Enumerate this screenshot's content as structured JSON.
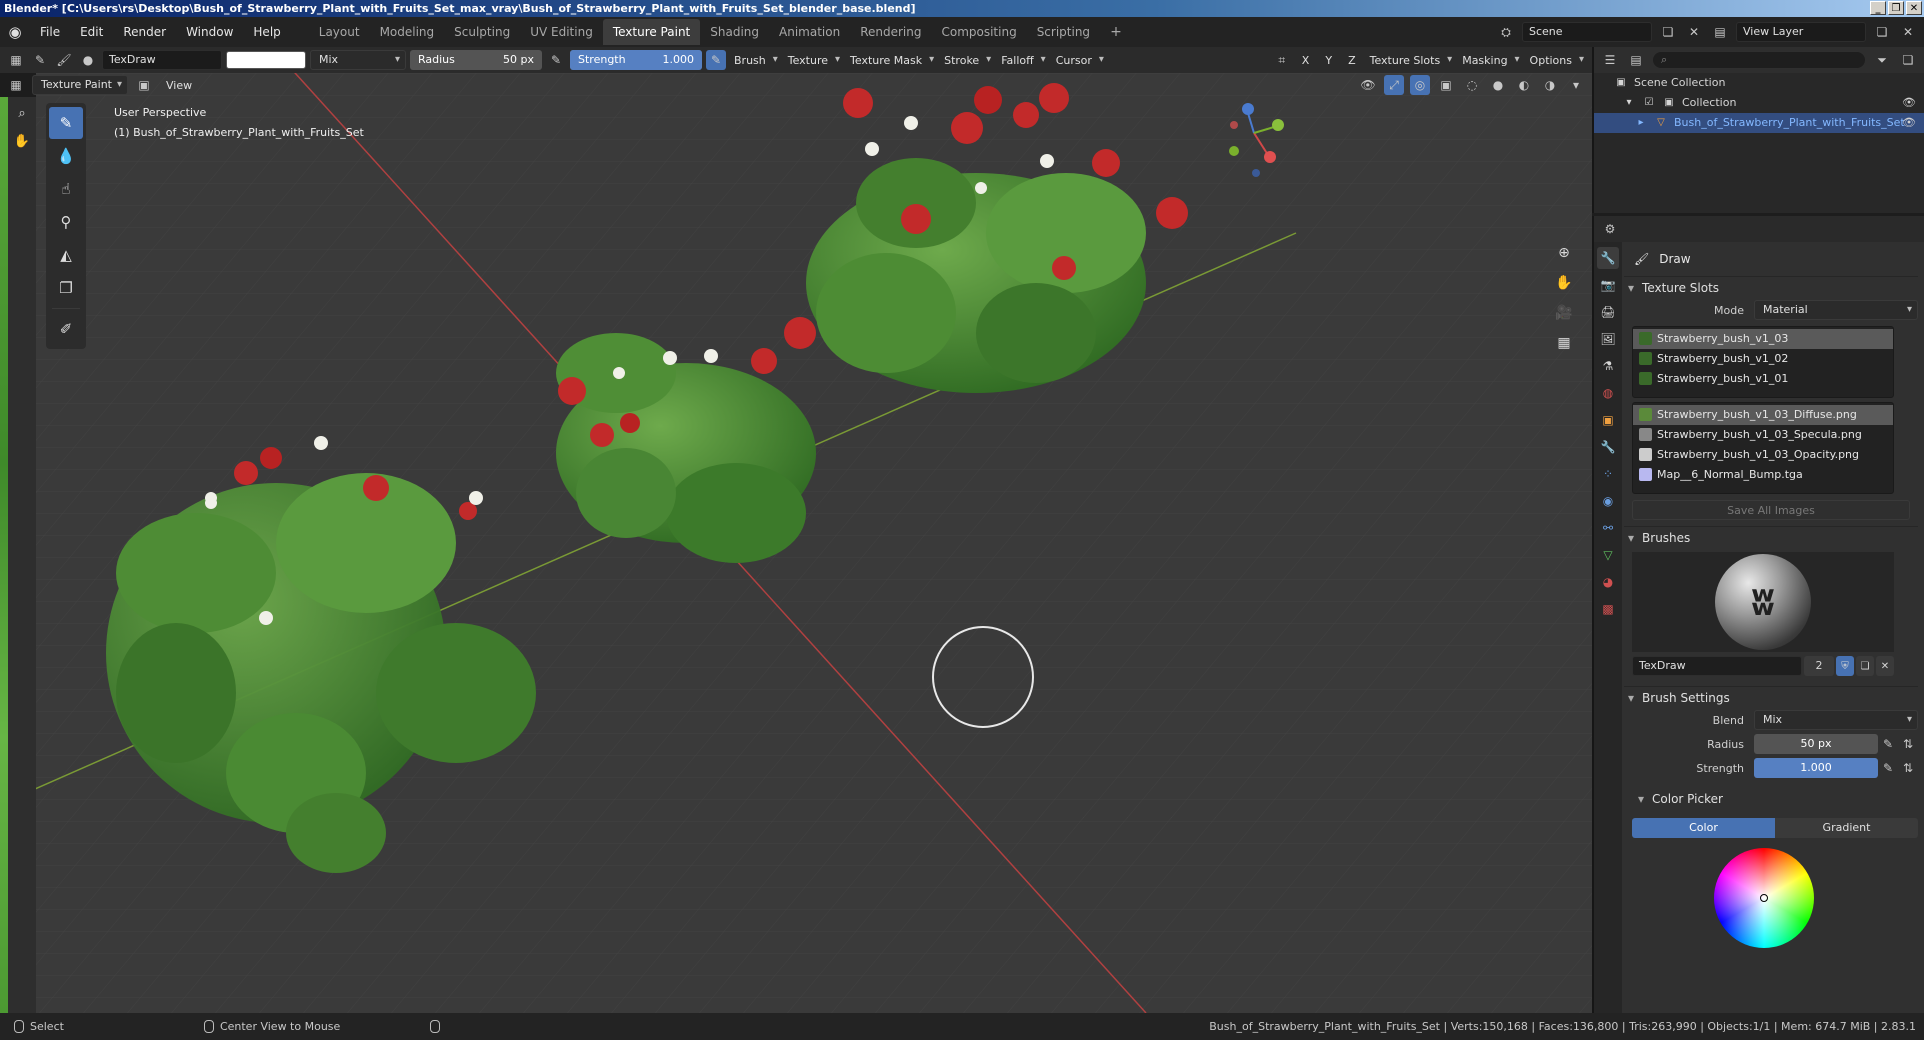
{
  "window": {
    "title": "Blender* [C:\\Users\\rs\\Desktop\\Bush_of_Strawberry_Plant_with_Fruits_Set_max_vray\\Bush_of_Strawberry_Plant_with_Fruits_Set_blender_base.blend]",
    "buttons": [
      "_",
      "❐",
      "✕"
    ]
  },
  "menu": [
    "File",
    "Edit",
    "Render",
    "Window",
    "Help"
  ],
  "workspaces": [
    "Layout",
    "Modeling",
    "Sculpting",
    "UV Editing",
    "Texture Paint",
    "Shading",
    "Animation",
    "Rendering",
    "Compositing",
    "Scripting"
  ],
  "active_workspace": "Texture Paint",
  "topright": {
    "scene": "Scene",
    "view_layer": "View Layer"
  },
  "toolhdr": {
    "brush_name": "TexDraw",
    "color": "#ffffff",
    "blend": "Mix",
    "radius_label": "Radius",
    "radius_value": "50 px",
    "strength_label": "Strength",
    "strength_value": "1.000",
    "strength_fraction": 1.0,
    "menus": [
      "Brush",
      "Texture",
      "Texture Mask",
      "Stroke",
      "Falloff",
      "Cursor"
    ],
    "axis": [
      "X",
      "Y",
      "Z"
    ],
    "right_menus": [
      "Texture Slots",
      "Masking",
      "Options"
    ]
  },
  "modehdr": {
    "mode": "Texture Paint",
    "view": "View"
  },
  "viewport": {
    "perspective": "User Perspective",
    "object": "(1) Bush_of_Strawberry_Plant_with_Fruits_Set"
  },
  "outliner": {
    "rows": [
      "Scene Collection",
      "Collection",
      "Bush_of_Strawberry_Plant_with_Fruits_Set"
    ]
  },
  "props": {
    "tool": "Draw",
    "texture_slots": {
      "title": "Texture Slots",
      "mode_label": "Mode",
      "mode_value": "Material",
      "materials": [
        "Strawberry_bush_v1_03",
        "Strawberry_bush_v1_02",
        "Strawberry_bush_v1_01"
      ],
      "images": [
        "Strawberry_bush_v1_03_Diffuse.png",
        "Strawberry_bush_v1_03_Specula.png",
        "Strawberry_bush_v1_03_Opacity.png",
        "Map__6_Normal_Bump.tga"
      ],
      "save_all": "Save All Images"
    },
    "brushes": {
      "title": "Brushes",
      "name": "TexDraw",
      "users": "2"
    },
    "brush_settings": {
      "title": "Brush Settings",
      "blend_label": "Blend",
      "blend_value": "Mix",
      "radius_label": "Radius",
      "radius_value": "50 px",
      "strength_label": "Strength",
      "strength_value": "1.000"
    },
    "color_picker": {
      "title": "Color Picker",
      "color_tab": "Color",
      "gradient_tab": "Gradient"
    }
  },
  "status": {
    "left": "Select",
    "middle": "Center View to Mouse",
    "stats": "Bush_of_Strawberry_Plant_with_Fruits_Set | Verts:150,168 | Faces:136,800 | Tris:263,990 | Objects:1/1 | Mem: 674.7 MiB | 2.83.1"
  }
}
